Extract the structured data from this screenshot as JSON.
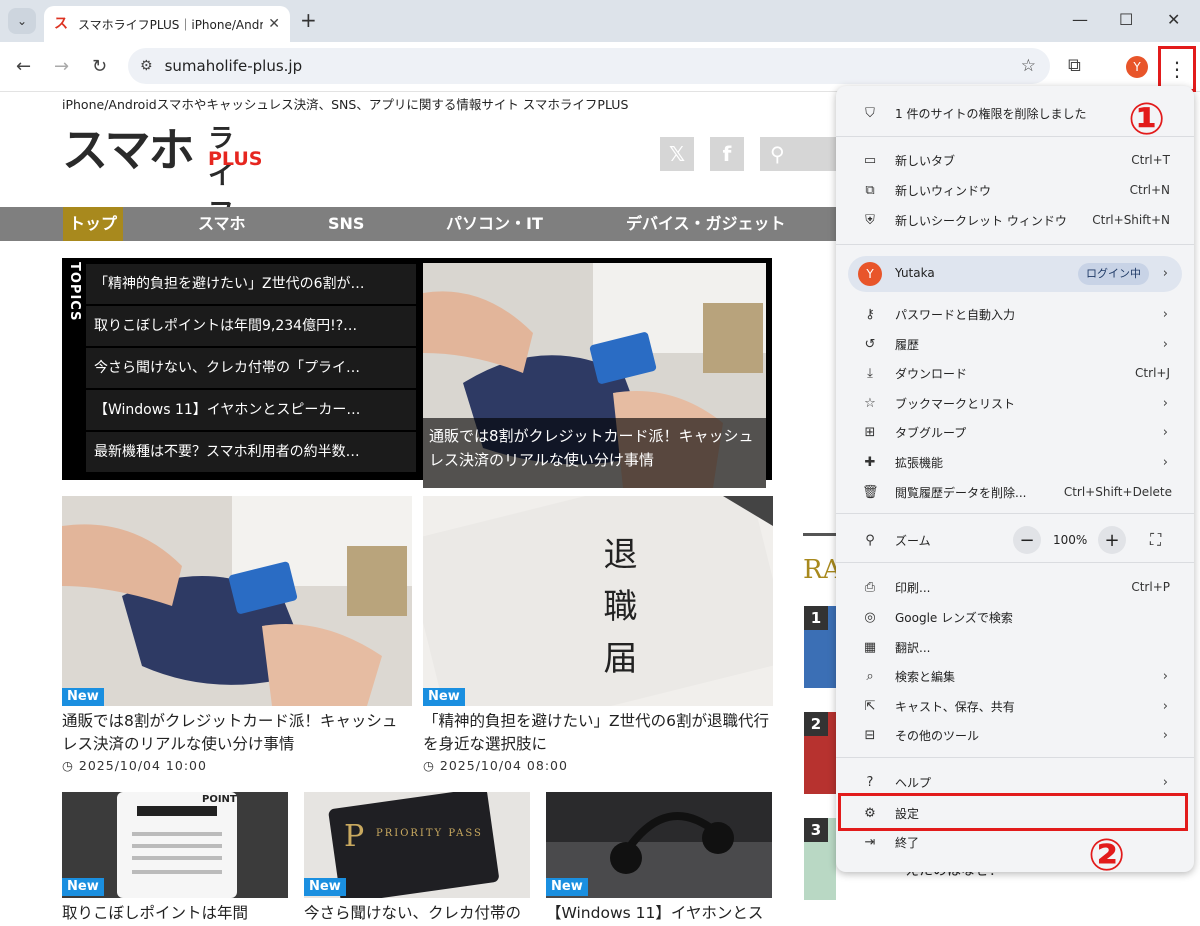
{
  "browser": {
    "tab_title": "スマホライフPLUS｜iPhone/Andro",
    "tab_favicon": "ス",
    "url": "sumaholife-plus.jp",
    "profile_initial": "Y"
  },
  "site": {
    "tagline": "iPhone/Androidスマホやキャッシュレス決済、SNS、アプリに関する情報サイト スマホライフPLUS",
    "logo_main": "スマホ",
    "logo_sub": "ライフ",
    "logo_plus": "PLUS",
    "nav": [
      "トップ",
      "スマホ",
      "SNS",
      "パソコン・IT",
      "デバイス・ガジェット"
    ],
    "topics_label": "TOPICS",
    "topics": [
      "「精神的負担を避けたい」Z世代の6割が…",
      "取りこぼしポイントは年間9,234億円!?…",
      "今さら聞けない、クレカ付帯の「プライ…",
      "【Windows 11】イヤホンとスピーカー…",
      "最新機種は不要？スマホ利用者の約半数…"
    ],
    "topic_feature_caption": "通販では8割がクレジットカード派！キャッシュレス決済のリアルな使い分け事情",
    "badge_new": "New",
    "cards": [
      {
        "title": "通販では8割がクレジットカード派！キャッシュレス決済のリアルな使い分け事情",
        "date": "2025/10/04 10:00"
      },
      {
        "title": "「精神的負担を避けたい」Z世代の6割が退職代行を身近な選択肢に",
        "date": "2025/10/04 08:00"
      }
    ],
    "small_cards": [
      {
        "title": "取りこぼしポイントは年間"
      },
      {
        "title": "今さら聞けない、クレカ付帯の"
      },
      {
        "title": "【Windows 11】イヤホンとス"
      }
    ],
    "ranking_head": "RA",
    "ranking_nums": [
      "1",
      "2",
      "3"
    ],
    "ranking_text": "えたのはなぜ？",
    "resign_letter": "退職届",
    "priority_pass": "PRIORITY PASS",
    "point_label": "POINT"
  },
  "menu": {
    "notice": "1 件のサイトの権限を削除しました",
    "new_tab": "新しいタブ",
    "new_tab_sc": "Ctrl+T",
    "new_window": "新しいウィンドウ",
    "new_window_sc": "Ctrl+N",
    "incognito": "新しいシークレット ウィンドウ",
    "incognito_sc": "Ctrl+Shift+N",
    "profile_name": "Yutaka",
    "profile_status": "ログイン中",
    "passwords": "パスワードと自動入力",
    "history": "履歴",
    "downloads": "ダウンロード",
    "downloads_sc": "Ctrl+J",
    "bookmarks": "ブックマークとリスト",
    "tab_groups": "タブグループ",
    "extensions": "拡張機能",
    "clear_data": "閲覧履歴データを削除...",
    "clear_data_sc": "Ctrl+Shift+Delete",
    "zoom": "ズーム",
    "zoom_value": "100%",
    "print": "印刷...",
    "print_sc": "Ctrl+P",
    "lens": "Google レンズで検索",
    "translate": "翻訳...",
    "find_edit": "検索と編集",
    "cast_save": "キャスト、保存、共有",
    "more_tools": "その他のツール",
    "help": "ヘルプ",
    "settings": "設定",
    "exit": "終了"
  },
  "annotations": {
    "step1": "①",
    "step2": "②"
  },
  "colors": {
    "accent_red": "#e21b1b",
    "nav_active": "#a8891d",
    "badge_blue": "#1a8fe0"
  }
}
